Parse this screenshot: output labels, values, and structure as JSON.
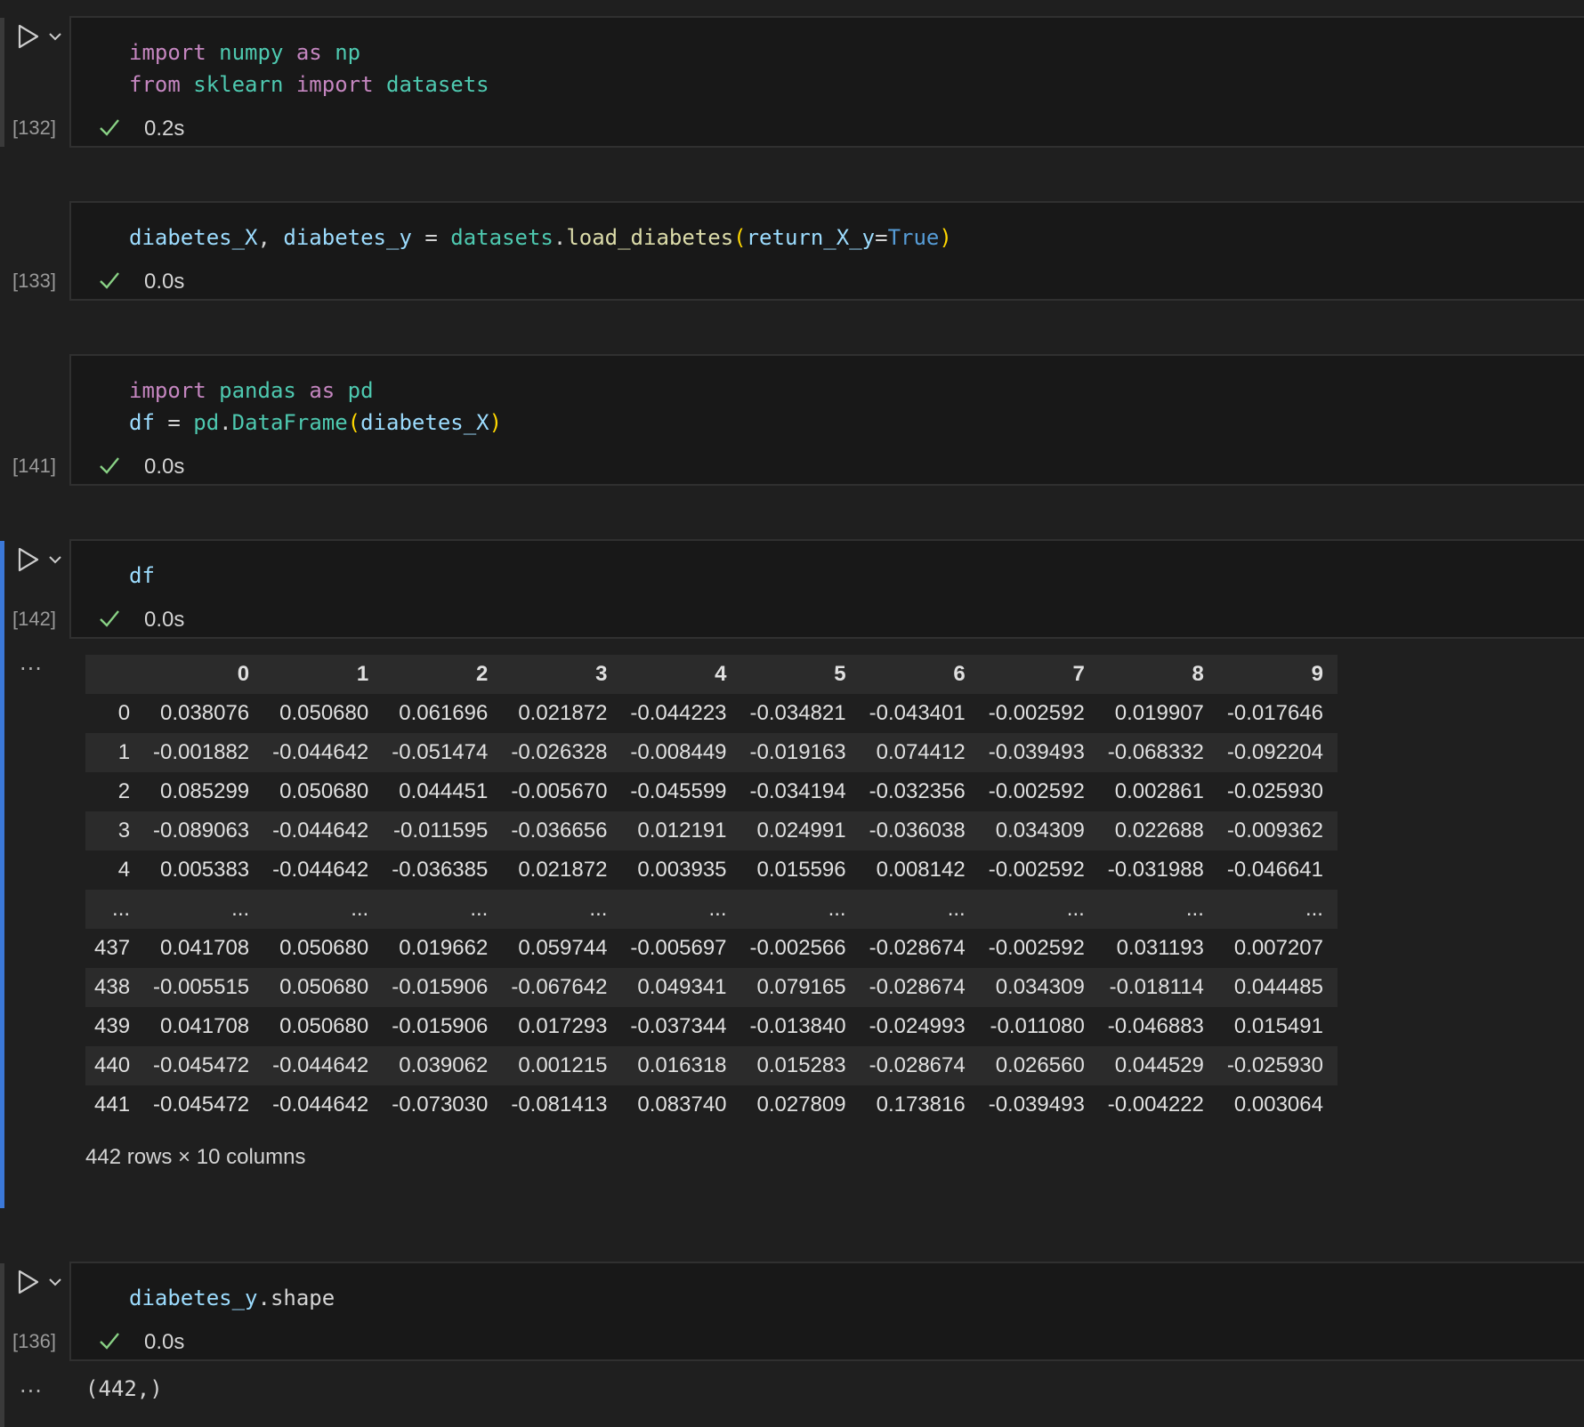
{
  "cells": [
    {
      "exec_count": "[132]",
      "duration": "0.2s",
      "lines": [
        [
          "import",
          "numpy",
          "as",
          "np"
        ],
        [
          "from",
          "sklearn",
          "import",
          "datasets"
        ]
      ]
    },
    {
      "exec_count": "[133]",
      "duration": "0.0s",
      "code": {
        "a": "diabetes_X",
        "sep": ", ",
        "b": "diabetes_y",
        "eq": " = ",
        "mod": "datasets",
        "dot": ".",
        "fn": "load_diabetes",
        "po": "(",
        "arg": "return_X_y",
        "as": "=",
        "lit": "True",
        "pc": ")"
      }
    },
    {
      "exec_count": "[141]",
      "duration": "0.0s",
      "code": {
        "kw1": "import",
        "mod1": "pandas",
        "kw2": "as",
        "alias": "pd",
        "v": "df",
        "eq": " = ",
        "mod2": "pd",
        "dot": ".",
        "fn": "DataFrame",
        "po": "(",
        "arg": "diabetes_X",
        "pc": ")"
      }
    },
    {
      "exec_count": "[142]",
      "duration": "0.0s",
      "code": {
        "v": "df"
      }
    },
    {
      "exec_count": "[136]",
      "duration": "0.0s",
      "code": {
        "v": "diabetes_y",
        "dot": ".",
        "attr": "shape"
      }
    }
  ],
  "output_menu_icon": "ellipsis-icon",
  "dataframe": {
    "columns": [
      "",
      "0",
      "1",
      "2",
      "3",
      "4",
      "5",
      "6",
      "7",
      "8",
      "9"
    ],
    "rows": [
      [
        "0",
        "0.038076",
        "0.050680",
        "0.061696",
        "0.021872",
        "-0.044223",
        "-0.034821",
        "-0.043401",
        "-0.002592",
        "0.019907",
        "-0.017646"
      ],
      [
        "1",
        "-0.001882",
        "-0.044642",
        "-0.051474",
        "-0.026328",
        "-0.008449",
        "-0.019163",
        "0.074412",
        "-0.039493",
        "-0.068332",
        "-0.092204"
      ],
      [
        "2",
        "0.085299",
        "0.050680",
        "0.044451",
        "-0.005670",
        "-0.045599",
        "-0.034194",
        "-0.032356",
        "-0.002592",
        "0.002861",
        "-0.025930"
      ],
      [
        "3",
        "-0.089063",
        "-0.044642",
        "-0.011595",
        "-0.036656",
        "0.012191",
        "0.024991",
        "-0.036038",
        "0.034309",
        "0.022688",
        "-0.009362"
      ],
      [
        "4",
        "0.005383",
        "-0.044642",
        "-0.036385",
        "0.021872",
        "0.003935",
        "0.015596",
        "0.008142",
        "-0.002592",
        "-0.031988",
        "-0.046641"
      ],
      [
        "...",
        "...",
        "...",
        "...",
        "...",
        "...",
        "...",
        "...",
        "...",
        "...",
        "..."
      ],
      [
        "437",
        "0.041708",
        "0.050680",
        "0.019662",
        "0.059744",
        "-0.005697",
        "-0.002566",
        "-0.028674",
        "-0.002592",
        "0.031193",
        "0.007207"
      ],
      [
        "438",
        "-0.005515",
        "0.050680",
        "-0.015906",
        "-0.067642",
        "0.049341",
        "0.079165",
        "-0.028674",
        "0.034309",
        "-0.018114",
        "0.044485"
      ],
      [
        "439",
        "0.041708",
        "0.050680",
        "-0.015906",
        "0.017293",
        "-0.037344",
        "-0.013840",
        "-0.024993",
        "-0.011080",
        "-0.046883",
        "0.015491"
      ],
      [
        "440",
        "-0.045472",
        "-0.044642",
        "0.039062",
        "0.001215",
        "0.016318",
        "0.015283",
        "-0.028674",
        "0.026560",
        "0.044529",
        "-0.025930"
      ],
      [
        "441",
        "-0.045472",
        "-0.044642",
        "-0.073030",
        "-0.081413",
        "0.083740",
        "0.027809",
        "0.173816",
        "-0.039493",
        "-0.004222",
        "0.003064"
      ]
    ],
    "caption": "442 rows × 10 columns"
  },
  "output_shape": "(442,)",
  "colors": {
    "accent": "#3b78d8",
    "check": "#89d185"
  }
}
